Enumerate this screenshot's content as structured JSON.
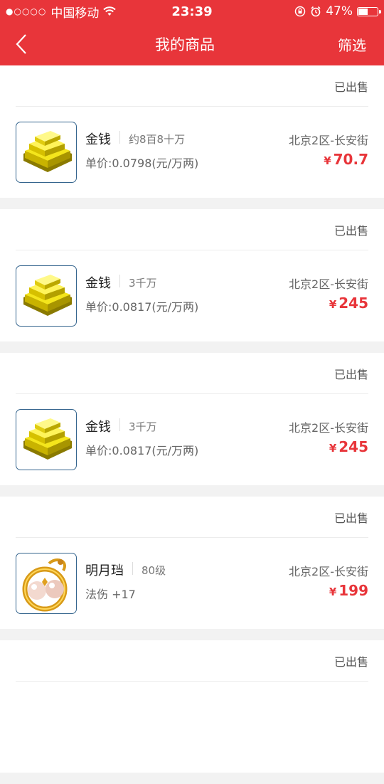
{
  "status_bar": {
    "signal": "●○○○○",
    "carrier": "中国移动",
    "time": "23:39",
    "battery_percent": "47%",
    "battery_level": 0.47
  },
  "nav": {
    "title": "我的商品",
    "filter_label": "筛选"
  },
  "items": [
    {
      "status": "已出售",
      "image": "gold-bars-icon",
      "name": "金钱",
      "quantity": "约8百8十万",
      "detail": "单价:0.0798(元/万两)",
      "server": "北京2区-长安街",
      "currency": "¥",
      "price": "70.7"
    },
    {
      "status": "已出售",
      "image": "gold-bars-icon",
      "name": "金钱",
      "quantity": "3千万",
      "detail": "单价:0.0817(元/万两)",
      "server": "北京2区-长安街",
      "currency": "¥",
      "price": "245"
    },
    {
      "status": "已出售",
      "image": "gold-bars-icon",
      "name": "金钱",
      "quantity": "3千万",
      "detail": "单价:0.0817(元/万两)",
      "server": "北京2区-长安街",
      "currency": "¥",
      "price": "245"
    },
    {
      "status": "已出售",
      "image": "pearl-earring-icon",
      "name": "明月珰",
      "quantity": "80级",
      "detail": "法伤 +17",
      "server": "北京2区-长安街",
      "currency": "¥",
      "price": "199"
    },
    {
      "status": "已出售"
    }
  ],
  "colors": {
    "brand": "#e8353a",
    "background": "#f2f2f2",
    "thumb_border": "#35658e"
  }
}
